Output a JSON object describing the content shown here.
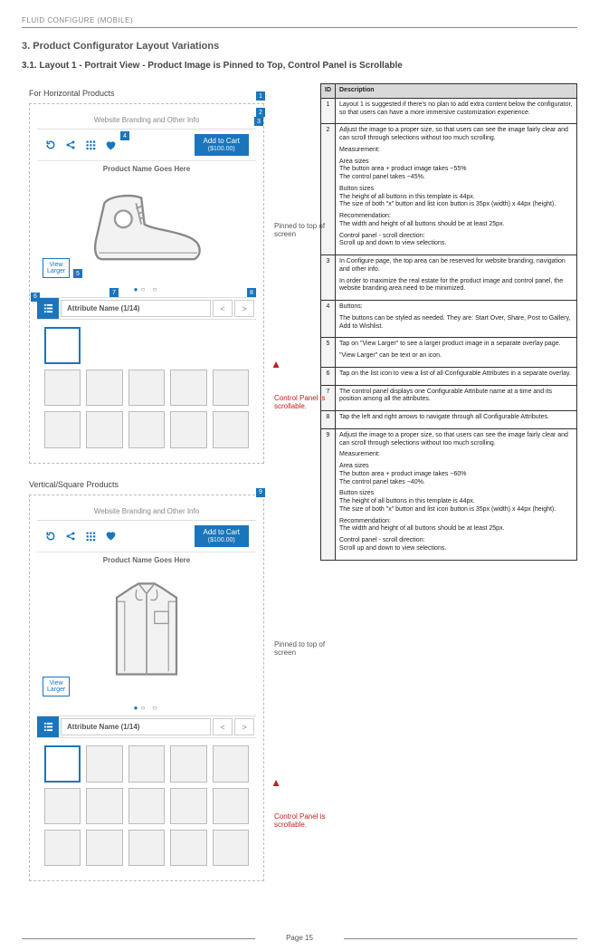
{
  "header": "FLUID CONFIGURE (MOBILE)",
  "section_number": "3.",
  "section_title": "Product Configurator Layout Variations",
  "subsection_number": "3.1.",
  "subsection_title": "Layout 1 - Portrait View - Product Image is Pinned to Top, Control Panel is Scrollable",
  "label_horizontal": "For Horizontal Products",
  "label_vertical": "Vertical/Square Products",
  "branding_text": "Website Branding and Other Info",
  "cart_label": "Add to Cart",
  "cart_price": "($100.00)",
  "product_name": "Product Name Goes Here",
  "view_larger": "View Larger",
  "attribute_name": "Attribute Name (1/14)",
  "annot_pinned": "Pinned to top of screen",
  "annot_scroll": "Control Panel is scrollable.",
  "page_footer": "Page 15",
  "table_head_id": "ID",
  "table_head_desc": "Description",
  "rows": [
    {
      "id": "1",
      "lines": [
        "Layout 1 is suggested if there's no plan to add extra content below the configurator, so that users can have a more immersive customization experience."
      ]
    },
    {
      "id": "2",
      "lines": [
        "Adjust the image to a proper size, so that users can see the image fairly clear and can scroll through selections without too much scrolling.",
        "Measurement:",
        "Area sizes\nThe button area + product image takes ~55%\nThe control panel takes ~45%.",
        "Button sizes\nThe height of all buttons in this template is 44px.\nThe size of both \"x\" button and list icon button is 35px (width) x 44px (height).",
        "Recommendation:\nThe width and height of all buttons should be at least 25px.",
        "Control panel - scroll direction:\nScroll up and down to view selections."
      ]
    },
    {
      "id": "3",
      "lines": [
        "In Configure page, the top area can be reserved for website branding, navigation and other info.",
        "In order to maximize the real estate for the product image and control panel, the website branding area need to be minimized."
      ]
    },
    {
      "id": "4",
      "lines": [
        "Buttons:",
        "The buttons can be styled as needed. They are: Start Over, Share, Post to Gallery, Add to Wishlist."
      ]
    },
    {
      "id": "5",
      "lines": [
        "Tap on \"View Larger\" to see a larger product image in a separate overlay page.",
        "\"View Larger\" can be text or an icon."
      ]
    },
    {
      "id": "6",
      "lines": [
        "Tap on the list icon to view a list of all Configurable Attributes in a separate overlay."
      ]
    },
    {
      "id": "7",
      "lines": [
        "The control panel displays one Configurable Attribute name at a time and its position among all the attributes."
      ]
    },
    {
      "id": "8",
      "lines": [
        "Tap the left and right arrows to navigate through all Configurable Attributes."
      ]
    },
    {
      "id": "9",
      "lines": [
        "Adjust the image to a proper size, so that users can see the image fairly clear and can scroll through selections without too much scrolling.",
        "Measurement:",
        "Area sizes\nThe button area + product image takes ~60%\nThe control panel takes ~40%.",
        "Button sizes\nThe height of all buttons in this template is 44px.\nThe size of both \"x\" button and list icon button is 35px (width) x 44px (height).",
        "Recommendation:\nThe width and height of all buttons should be at least 25px.",
        "Control panel - scroll direction:\nScroll up and down to view selections."
      ]
    }
  ]
}
